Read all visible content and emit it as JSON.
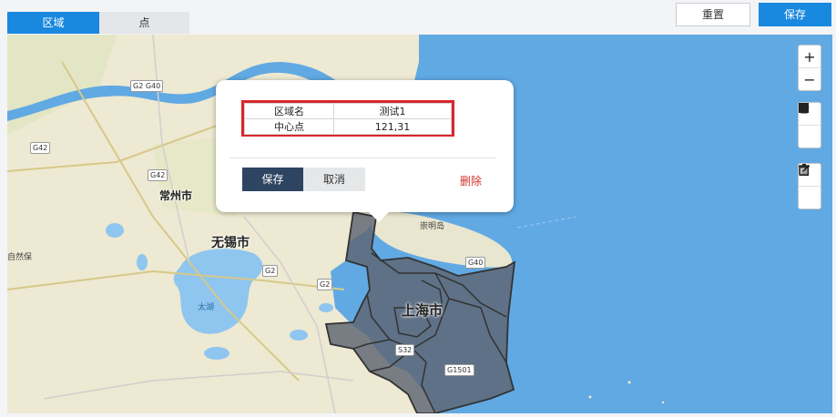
{
  "tabs": [
    {
      "label": "区域",
      "active": true
    },
    {
      "label": "点",
      "active": false
    }
  ],
  "toolbar": {
    "reset_label": "重置",
    "save_label": "保存"
  },
  "map": {
    "labels": {
      "changzhou": "常州市",
      "wuxi": "无锡市",
      "shanghai": "上海市",
      "taihu": "太湖",
      "chongming": "崇明岛",
      "nature_reserve": "自然保"
    },
    "highway_shields": [
      "G2 G40",
      "G42",
      "G42",
      "G2",
      "G2",
      "G40",
      "S32",
      "G1501"
    ],
    "controls": {
      "zoom_in": "+",
      "zoom_out": "−",
      "draw_polygon": "polygon-icon",
      "draw_rectangle": "rectangle-icon",
      "edit": "edit-icon",
      "delete": "trash-icon"
    },
    "colors": {
      "sea": "#61a9e3",
      "land": "#eee9d2",
      "region_fill": "#5e6472",
      "highlight": "#d9262c"
    }
  },
  "popup": {
    "rows": [
      {
        "key": "区域名",
        "value": "测试1"
      },
      {
        "key": "中心点",
        "value": "121,31"
      }
    ],
    "save_label": "保存",
    "cancel_label": "取消",
    "delete_label": "删除"
  }
}
